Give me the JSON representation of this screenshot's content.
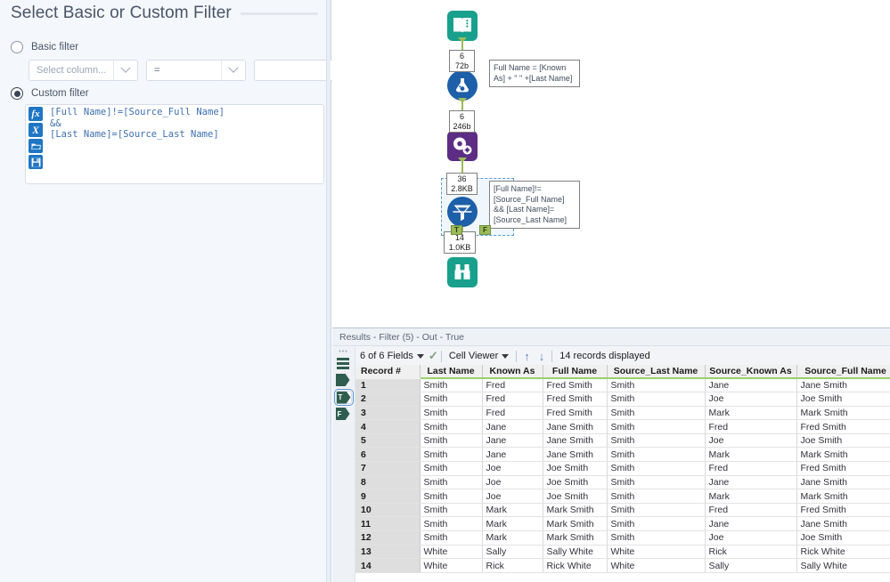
{
  "config_panel": {
    "title": "Select Basic or Custom Filter",
    "basic_filter": {
      "label": "Basic filter",
      "selected": false,
      "column_placeholder": "Select column...",
      "operator_value": "=",
      "value_text": ""
    },
    "custom_filter": {
      "label": "Custom filter",
      "selected": true,
      "expression": "[Full Name]!=[Source_Full Name]\n&&\n[Last Name]=[Source_Last Name]",
      "toolbar": [
        {
          "name": "formula-icon",
          "glyph": "fx"
        },
        {
          "name": "variable-icon",
          "glyph": "X"
        },
        {
          "name": "open-folder-icon",
          "glyph": "▱"
        },
        {
          "name": "save-icon",
          "glyph": "▣"
        }
      ]
    }
  },
  "canvas": {
    "tools": [
      {
        "name": "input-data-tool",
        "icon": "book-icon",
        "color": "#18a08c"
      },
      {
        "name": "formula-tool",
        "icon": "flask-icon",
        "color": "#1d5fa8"
      },
      {
        "name": "multi-field-formula-tool",
        "icon": "gears-icon",
        "color": "#5c2d83"
      },
      {
        "name": "filter-tool",
        "icon": "funnel-icon",
        "color": "#1d5fa8"
      },
      {
        "name": "browse-tool",
        "icon": "binoculars-icon",
        "color": "#18a08c"
      }
    ],
    "connection_labels": [
      {
        "records": "6",
        "size": "72b"
      },
      {
        "records": "6",
        "size": "246b"
      },
      {
        "records": "36",
        "size": "2.8KB"
      },
      {
        "records": "14",
        "size": "1.0KB"
      }
    ],
    "annotations": [
      "Full Name = [Known As] + \" \" +[Last Name]",
      "[Full Name]!=\n[Source_Full Name]\n&&\n[Last Name]=\n[Source_Last Name]"
    ],
    "filter_anchors": {
      "true_label": "T",
      "false_label": "F"
    }
  },
  "results": {
    "title": "Results - Filter (5) - Out - True",
    "toolbar": {
      "fields_label": "6 of 6 Fields",
      "view_mode": "Cell Viewer",
      "records_label": "14 records displayed",
      "up_arrow": "↑",
      "down_arrow": "↓",
      "check": "✓"
    },
    "sidebar_anchors": [
      {
        "name": "anchor-true",
        "label": "T",
        "selected": true
      },
      {
        "name": "anchor-false",
        "label": "F",
        "selected": false
      }
    ],
    "grid": {
      "columns": [
        "Record #",
        "Last Name",
        "Known As",
        "Full Name",
        "Source_Last Name",
        "Source_Known As",
        "Source_Full Name"
      ],
      "rows": [
        [
          "1",
          "Smith",
          "Fred",
          "Fred Smith",
          "Smith",
          "Jane",
          "Jane Smith"
        ],
        [
          "2",
          "Smith",
          "Fred",
          "Fred Smith",
          "Smith",
          "Joe",
          "Joe Smith"
        ],
        [
          "3",
          "Smith",
          "Fred",
          "Fred Smith",
          "Smith",
          "Mark",
          "Mark Smith"
        ],
        [
          "4",
          "Smith",
          "Jane",
          "Jane Smith",
          "Smith",
          "Fred",
          "Fred Smith"
        ],
        [
          "5",
          "Smith",
          "Jane",
          "Jane Smith",
          "Smith",
          "Joe",
          "Joe Smith"
        ],
        [
          "6",
          "Smith",
          "Jane",
          "Jane Smith",
          "Smith",
          "Mark",
          "Mark Smith"
        ],
        [
          "7",
          "Smith",
          "Joe",
          "Joe Smith",
          "Smith",
          "Fred",
          "Fred Smith"
        ],
        [
          "8",
          "Smith",
          "Joe",
          "Joe Smith",
          "Smith",
          "Jane",
          "Jane Smith"
        ],
        [
          "9",
          "Smith",
          "Joe",
          "Joe Smith",
          "Smith",
          "Mark",
          "Mark Smith"
        ],
        [
          "10",
          "Smith",
          "Mark",
          "Mark Smith",
          "Smith",
          "Fred",
          "Fred Smith"
        ],
        [
          "11",
          "Smith",
          "Mark",
          "Mark Smith",
          "Smith",
          "Jane",
          "Jane Smith"
        ],
        [
          "12",
          "Smith",
          "Mark",
          "Mark Smith",
          "Smith",
          "Joe",
          "Joe Smith"
        ],
        [
          "13",
          "White",
          "Sally",
          "Sally White",
          "White",
          "Rick",
          "Rick White"
        ],
        [
          "14",
          "White",
          "Rick",
          "Rick White",
          "White",
          "Sally",
          "Sally White"
        ]
      ]
    }
  },
  "colors": {
    "panel_bg": "#f4f7fb",
    "accent_blue": "#1f76c4",
    "wire_green": "#9bbb59",
    "header_underline": "#9ad06a",
    "teal_tool": "#18a08c",
    "purple_tool": "#5c2d83"
  }
}
